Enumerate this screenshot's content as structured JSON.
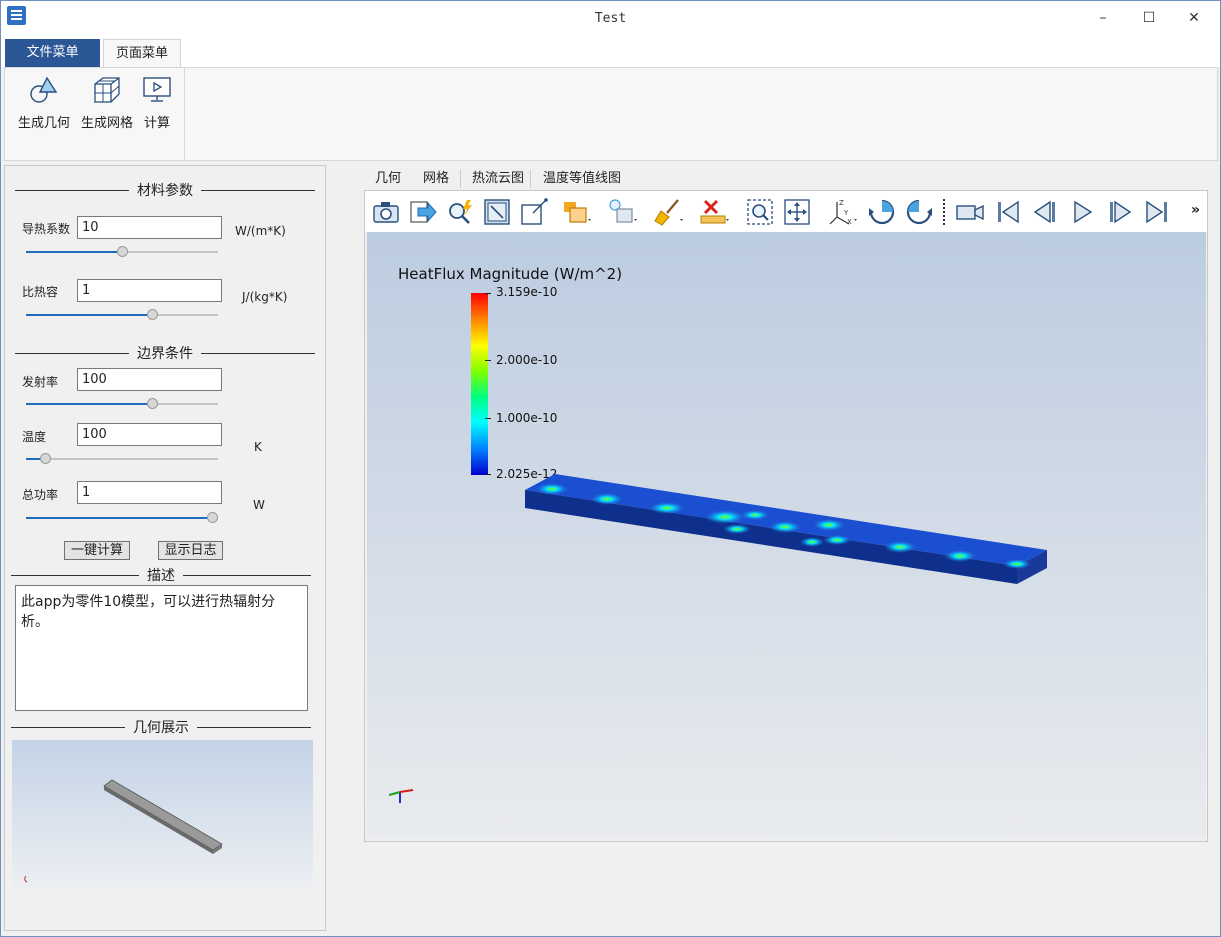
{
  "window": {
    "title": "Test"
  },
  "window_controls": {
    "minimize": "–",
    "maximize": "☐",
    "close": "✕"
  },
  "menu_tabs": [
    "文件菜单",
    "页面菜单"
  ],
  "ribbon_buttons": [
    "生成几何",
    "生成网格",
    "计算"
  ],
  "material": {
    "title": "材料参数",
    "conductivity": {
      "label": "导热系数",
      "value": "10",
      "unit": "W/(m*K)",
      "slider": 0.5
    },
    "specific_heat": {
      "label": "比热容",
      "value": "1",
      "unit": "J/(kg*K)",
      "slider": 0.67
    }
  },
  "boundary": {
    "title": "边界条件",
    "emissivity": {
      "label": "发射率",
      "value": "100",
      "unit": "",
      "slider": 0.67
    },
    "temperature": {
      "label": "温度",
      "value": "100",
      "unit": "K",
      "slider": 0.08
    },
    "power": {
      "label": "总功率",
      "value": "1",
      "unit": "W",
      "slider": 1.0
    }
  },
  "actions": {
    "calculate": "一键计算",
    "show_log": "显示日志"
  },
  "description": {
    "title": "描述",
    "text": "此app为零件10模型，可以进行热辐射分析。"
  },
  "geometry_preview": {
    "title": "几何展示"
  },
  "view_tabs": [
    "几何",
    "网格",
    "热流云图",
    "温度等值线图"
  ],
  "toolbar_icons": [
    "camera-icon",
    "export-icon",
    "query-icon",
    "select-surface-icon",
    "select-point-icon",
    "show-box-icon",
    "light-box-icon",
    "brush-icon",
    "delete-ruler-icon",
    "zoom-box-icon",
    "fit-view-icon",
    "axes-icon",
    "rotate-cw-icon",
    "rotate-ccw-icon",
    "video-camera-icon",
    "first-frame-icon",
    "prev-frame-icon",
    "play-icon",
    "next-frame-icon",
    "last-frame-icon",
    "more-icon"
  ],
  "colorbar": {
    "title": "HeatFlux Magnitude (W/m^2)",
    "max": "3.159e-10",
    "mid1": "2.000e-10",
    "mid2": "1.000e-10",
    "min": "2.025e-12"
  },
  "accent_color": "#2b5797"
}
